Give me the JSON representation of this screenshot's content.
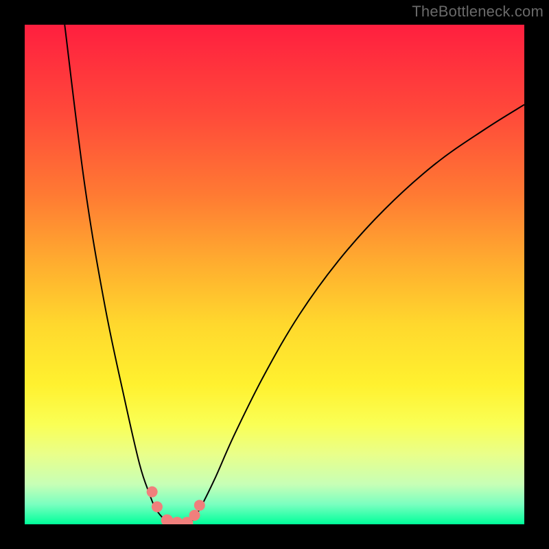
{
  "branding": {
    "watermark": "TheBottleneck.com"
  },
  "chart_data": {
    "type": "line",
    "title": "",
    "xlabel": "",
    "ylabel": "",
    "xlim": [
      0,
      100
    ],
    "ylim": [
      0,
      100
    ],
    "grid": false,
    "legend": false,
    "background_gradient": {
      "orientation": "vertical",
      "stops": [
        {
          "pos": 0.0,
          "color": "#ff1f3f"
        },
        {
          "pos": 0.18,
          "color": "#ff4a3a"
        },
        {
          "pos": 0.34,
          "color": "#ff7a33"
        },
        {
          "pos": 0.48,
          "color": "#ffae2f"
        },
        {
          "pos": 0.6,
          "color": "#ffd82d"
        },
        {
          "pos": 0.72,
          "color": "#fff12f"
        },
        {
          "pos": 0.8,
          "color": "#faff55"
        },
        {
          "pos": 0.86,
          "color": "#e9ff8a"
        },
        {
          "pos": 0.92,
          "color": "#c7ffb6"
        },
        {
          "pos": 0.96,
          "color": "#7affc0"
        },
        {
          "pos": 1.0,
          "color": "#00ff9a"
        }
      ]
    },
    "series": [
      {
        "name": "left-curve",
        "x": [
          8,
          12,
          16,
          20,
          23,
          25,
          26,
          27,
          28,
          29,
          30
        ],
        "y": [
          100,
          68,
          44,
          25,
          12,
          6,
          3.5,
          2,
          1,
          0.4,
          0
        ]
      },
      {
        "name": "right-curve",
        "x": [
          33,
          35,
          38,
          42,
          48,
          55,
          63,
          72,
          82,
          92,
          100
        ],
        "y": [
          0,
          3,
          9,
          18,
          30,
          42,
          53,
          63,
          72,
          79,
          84
        ]
      }
    ],
    "markers": [
      {
        "name": "marker-a",
        "x": 25.5,
        "y": 6.5,
        "r": 1.1,
        "color": "#f07f7c"
      },
      {
        "name": "marker-b",
        "x": 26.5,
        "y": 3.5,
        "r": 1.1,
        "color": "#f07f7c"
      },
      {
        "name": "marker-c",
        "x": 28.5,
        "y": 0.8,
        "r": 1.2,
        "color": "#f07f7c"
      },
      {
        "name": "marker-d",
        "x": 30.5,
        "y": 0.3,
        "r": 1.2,
        "color": "#f07f7c"
      },
      {
        "name": "marker-e",
        "x": 32.5,
        "y": 0.3,
        "r": 1.2,
        "color": "#f07f7c"
      },
      {
        "name": "marker-f",
        "x": 34.0,
        "y": 1.8,
        "r": 1.1,
        "color": "#f07f7c"
      },
      {
        "name": "marker-g",
        "x": 35.0,
        "y": 3.8,
        "r": 1.1,
        "color": "#f07f7c"
      }
    ],
    "curve_stroke": {
      "color": "#000000",
      "width": 2
    }
  }
}
